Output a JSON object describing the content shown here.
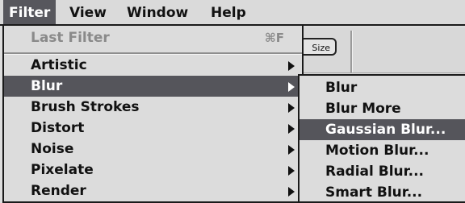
{
  "menubar": {
    "items": [
      {
        "label": "Filter",
        "active": true
      },
      {
        "label": "View"
      },
      {
        "label": "Window"
      },
      {
        "label": "Help"
      }
    ]
  },
  "background_window": {
    "button_label": "Size"
  },
  "filter_menu": {
    "last_filter": {
      "label": "Last Filter",
      "shortcut": "⌘F",
      "disabled": true
    },
    "items": [
      {
        "label": "Artistic",
        "submenu": true
      },
      {
        "label": "Blur",
        "submenu": true,
        "highlighted": true
      },
      {
        "label": "Brush Strokes",
        "submenu": true
      },
      {
        "label": "Distort",
        "submenu": true
      },
      {
        "label": "Noise",
        "submenu": true
      },
      {
        "label": "Pixelate",
        "submenu": true
      },
      {
        "label": "Render",
        "submenu": true
      }
    ]
  },
  "blur_submenu": {
    "items": [
      {
        "label": "Blur"
      },
      {
        "label": "Blur More"
      },
      {
        "label": "Gaussian Blur...",
        "highlighted": true
      },
      {
        "label": "Motion Blur..."
      },
      {
        "label": "Radial Blur..."
      },
      {
        "label": "Smart Blur..."
      }
    ]
  },
  "colors": {
    "highlight": "#55555b",
    "menu_bg": "#dcdcdc",
    "disabled_text": "#8a8a8a"
  }
}
